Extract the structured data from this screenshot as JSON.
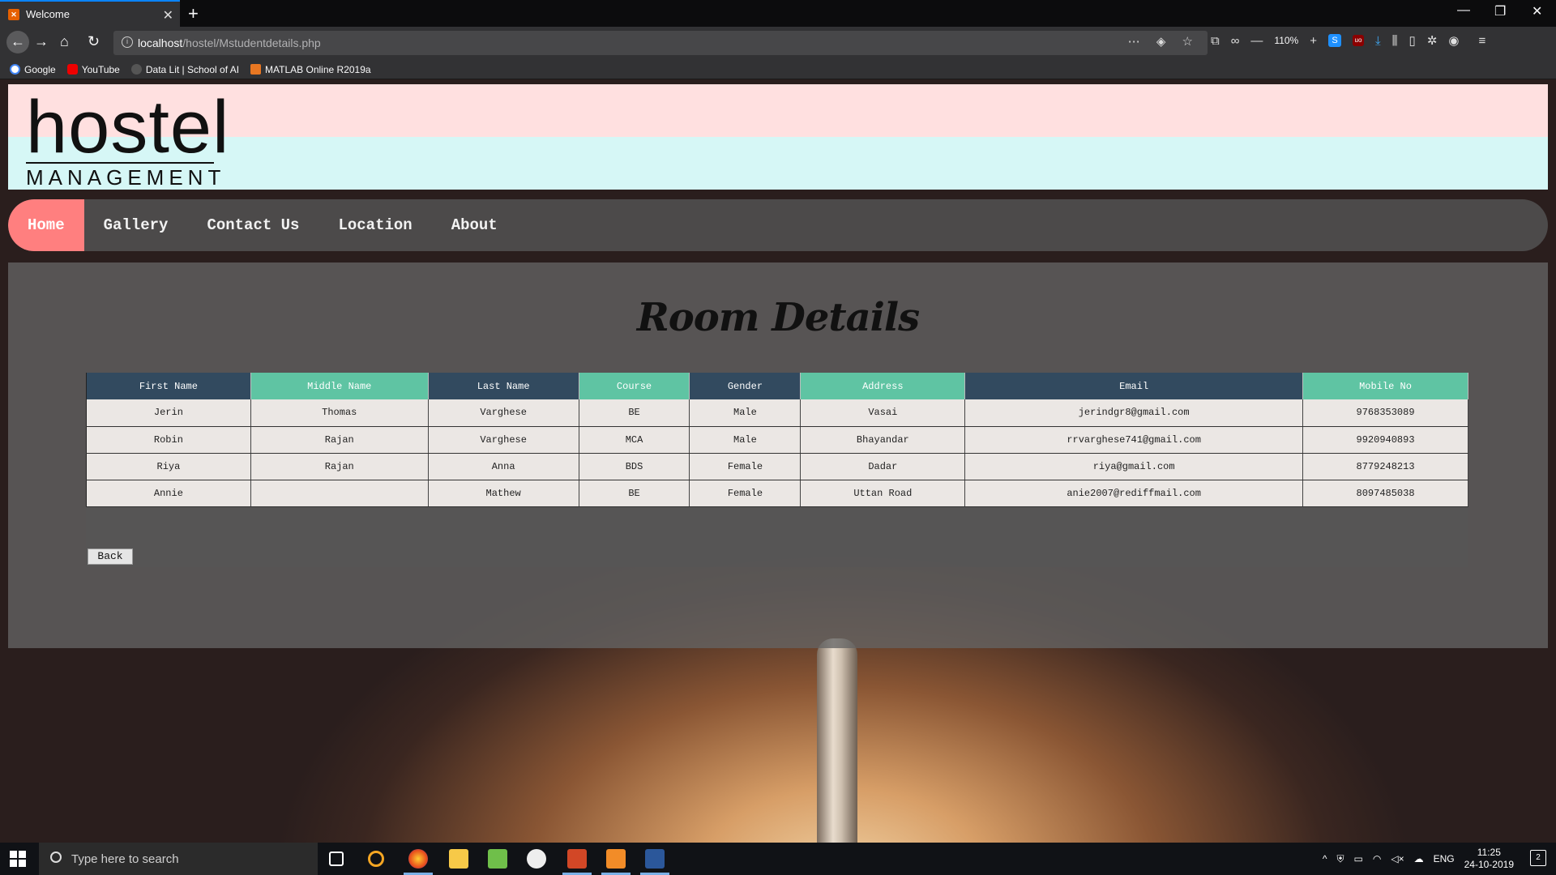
{
  "browser": {
    "tab_title": "Welcome",
    "url_host": "localhost",
    "url_path": "/hostel/Mstudentdetails.php",
    "zoom": "110%",
    "bookmarks": [
      "Google",
      "YouTube",
      "Data Lit | School of AI",
      "MATLAB Online R2019a"
    ]
  },
  "header": {
    "logo_main": "hostel",
    "logo_sub": "MANAGEMENT"
  },
  "menu": {
    "items": [
      "Home",
      "Gallery",
      "Contact Us",
      "Location",
      "About"
    ],
    "active": "Home"
  },
  "main": {
    "title": "Room Details",
    "columns": [
      "First Name",
      "Middle Name",
      "Last Name",
      "Course",
      "Gender",
      "Address",
      "Email",
      "Mobile No"
    ],
    "rows": [
      [
        "Jerin",
        "Thomas",
        "Varghese",
        "BE",
        "Male",
        "Vasai",
        "jerindgr8@gmail.com",
        "9768353089"
      ],
      [
        "Robin",
        "Rajan",
        "Varghese",
        "MCA",
        "Male",
        "Bhayandar",
        "rrvarghese741@gmail.com",
        "9920940893"
      ],
      [
        "Riya",
        "Rajan",
        "Anna",
        "BDS",
        "Female",
        "Dadar",
        "riya@gmail.com",
        "8779248213"
      ],
      [
        "Annie",
        "",
        "Mathew",
        "BE",
        "Female",
        "Uttan Road",
        "anie2007@rediffmail.com",
        "8097485038"
      ]
    ],
    "back_label": "Back"
  },
  "taskbar": {
    "search_placeholder": "Type here to search",
    "lang": "ENG",
    "time": "11:25",
    "date": "24-10-2019",
    "notifications": "2"
  },
  "colors": {
    "menu_active": "#ff7f7f",
    "header_dark": "#324a5f",
    "header_green": "#5fc4a3"
  }
}
